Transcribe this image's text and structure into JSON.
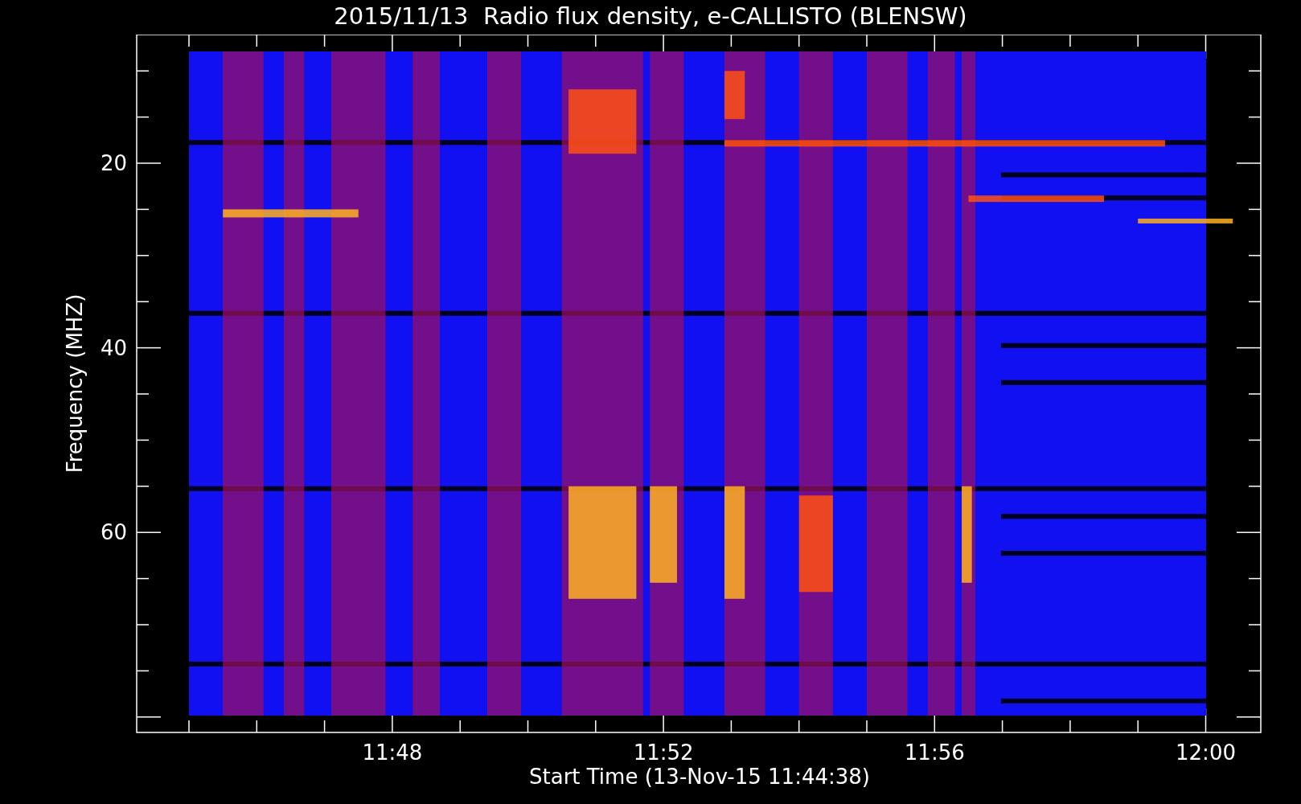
{
  "title": "2015/11/13  Radio flux density, e-CALLISTO (BLENSW)",
  "y_axis": {
    "label": "Frequency (MHZ)",
    "ticks": [
      "20",
      "40",
      "60"
    ]
  },
  "x_axis": {
    "label": "Start Time (13-Nov-15 11:44:38)",
    "ticks": [
      "11:48",
      "11:52",
      "11:56",
      "12:00"
    ]
  }
}
